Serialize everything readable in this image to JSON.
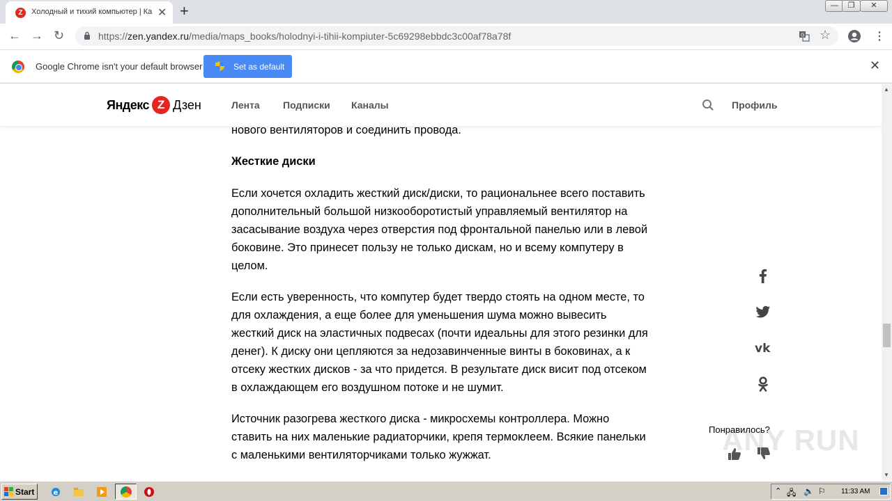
{
  "browser": {
    "tab_title": "Холодный и тихий компьютер | Ка",
    "url_prefix": "https://",
    "url_host": "zen.yandex.ru",
    "url_path": "/media/maps_books/holodnyi-i-tihii-kompiuter-5c69298ebbdc3c00af78a78f",
    "window_controls": [
      "minimize",
      "restore",
      "close"
    ]
  },
  "infobar": {
    "message": "Google Chrome isn't your default browser",
    "button_label": "Set as default"
  },
  "site": {
    "logo_left": "Яндекс",
    "logo_letter": "Z",
    "logo_right": "Дзен",
    "nav": [
      "Лента",
      "Подписки",
      "Каналы"
    ],
    "profile": "Профиль"
  },
  "article": {
    "fragment": "нового вентиляторов и соединить провода.",
    "heading": "Жесткие диски",
    "paragraphs": [
      "Если хочется охладить жесткий диск/диски, то рациональнее всего поставить дополнительный большой низкооборотистый управляемый вентилятор на засасывание воздуха через отверстия под фронтальной панелью или в левой боковине. Это принесет пользу не только дискам, но и всему компутеру в целом.",
      "Если есть уверенность, что компутер будет твердо стоять на одном месте, то для охлаждения, а еще более для уменьшения шума можно вывесить жесткий диск на эластичных подвесах (почти идеальны для этого резинки для денег). К диску они цепляются за недозавинченные винты в боковинах, а к отсеку жестких дисков - за что придется. В результате диск висит под отсеком в охлаждающем его воздушном потоке и не шумит.",
      "Источник разогрева жесткого диска - микросхемы контроллера. Можно ставить на них маленькие радиаторчики, крепя термоклеем. Всякие панельки с маленькими вентиляторчиками только жужжат."
    ]
  },
  "social": [
    "facebook-icon",
    "twitter-icon",
    "vk-icon",
    "odnoklassniki-icon"
  ],
  "feedback": {
    "question": "Понравилось?"
  },
  "watermark": "ANY RUN",
  "taskbar": {
    "start_label": "Start",
    "clock": "11:33 AM"
  }
}
